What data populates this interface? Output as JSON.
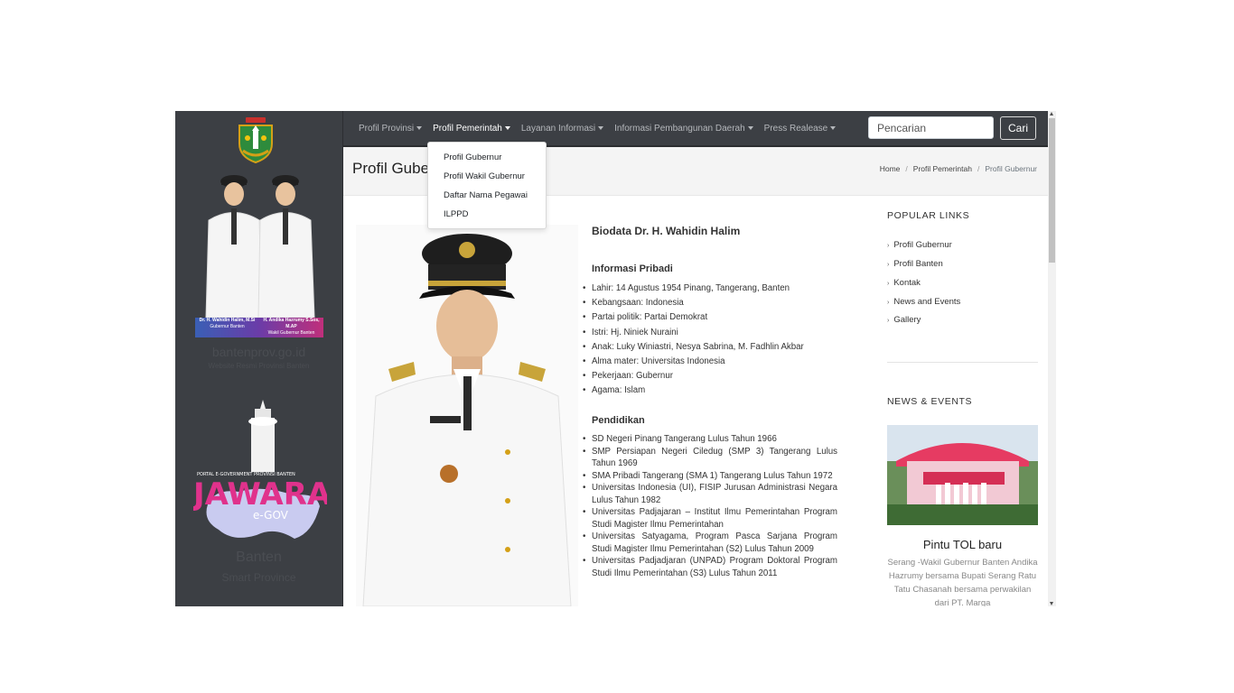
{
  "sidebar": {
    "caption_left_name": "Dr. H. Wahidin Halim, M.Si",
    "caption_left_role": "Gubernur Banten",
    "caption_right_name": "H. Andika Hazrumy S.Sos, M.AP",
    "caption_right_role": "Wakil Gubernur Banten",
    "site_url": "bantenprov.go.id",
    "site_subtitle": "Website Resmi Provinsi Banten",
    "portal_label": "PORTAL E-GOVERNMENT PROVINSI BANTEN",
    "jawara_logo": "JAWARA",
    "egov_label": "e-GOV",
    "region": "Banten",
    "tagline": "Smart Province"
  },
  "navbar": {
    "items": [
      {
        "label": "Profil Provinsi"
      },
      {
        "label": "Profil Pemerintah"
      },
      {
        "label": "Layanan Informasi"
      },
      {
        "label": "Informasi Pembangunan Daerah"
      },
      {
        "label": "Press Realease"
      }
    ],
    "search_placeholder": "Pencarian",
    "search_button": "Cari"
  },
  "dropdown": {
    "items": [
      {
        "label": "Profil Gubernur"
      },
      {
        "label": "Profil Wakil Gubernur"
      },
      {
        "label": "Daftar Nama Pegawai"
      },
      {
        "label": "ILPPD"
      }
    ]
  },
  "header": {
    "title": "Profil Gubernur",
    "breadcrumb": [
      "Home",
      "Profil Pemerintah",
      "Profil Gubernur"
    ]
  },
  "bio": {
    "heading": "Biodata Dr. H. Wahidin Halim",
    "personal_heading": "Informasi Pribadi",
    "personal": [
      "Lahir: 14 Agustus 1954 Pinang, Tangerang, Banten",
      "Kebangsaan: Indonesia",
      "Partai politik: Partai Demokrat",
      "Istri: Hj. Niniek Nuraini",
      "Anak: Luky Winiastri, Nesya Sabrina, M. Fadhlin Akbar",
      "Alma mater: Universitas Indonesia",
      "Pekerjaan: Gubernur",
      "Agama: Islam"
    ],
    "education_heading": "Pendidikan",
    "education": [
      "SD Negeri Pinang Tangerang Lulus Tahun 1966",
      "SMP Persiapan Negeri Ciledug (SMP 3) Tangerang Lulus Tahun 1969",
      "SMA Pribadi Tangerang (SMA 1) Tangerang Lulus Tahun 1972",
      "Universitas Indonesia (UI), FISIP Jurusan Administrasi Negara Lulus Tahun 1982",
      "Universitas Padjajaran – Institut Ilmu Pemerintahan Program Studi Magister Ilmu Pemerintahan",
      "Universitas Satyagama, Program Pasca Sarjana Program Studi Magister Ilmu Pemerintahan (S2) Lulus Tahun 2009",
      "Universitas Padjadjaran (UNPAD) Program Doktoral Program Studi Ilmu Pemerintahan (S3) Lulus Tahun 2011"
    ]
  },
  "popular": {
    "title": "POPULAR LINKS",
    "links": [
      {
        "label": "Profil Gubernur"
      },
      {
        "label": "Profil Banten"
      },
      {
        "label": "Kontak"
      },
      {
        "label": "News and Events"
      },
      {
        "label": "Gallery"
      }
    ]
  },
  "news": {
    "title": "NEWS & EVENTS",
    "item_title": "Pintu TOL baru",
    "item_excerpt": "Serang -Wakil Gubernur Banten Andika Hazrumy bersama Bupati Serang Ratu Tatu Chasanah bersama perwakilan dari PT. Marga"
  },
  "colors": {
    "sidebar_bg": "#3c3f44",
    "navbar_bg": "#3c3f44",
    "header_bg": "#f4f4f4"
  }
}
